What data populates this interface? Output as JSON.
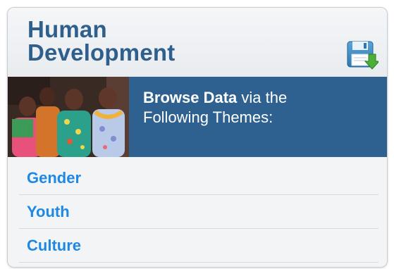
{
  "widget": {
    "title_line1": "Human",
    "title_line2": "Development",
    "save_icon": "save-download-icon"
  },
  "banner": {
    "photo_alt": "Group of women in floral dresses",
    "lead_bold": "Browse Data",
    "lead_rest": "via the",
    "line2": "Following Themes:"
  },
  "themes": [
    {
      "label": "Gender"
    },
    {
      "label": "Youth"
    },
    {
      "label": "Culture"
    }
  ],
  "colors": {
    "title": "#2f5f8c",
    "banner_bg": "#2e6190",
    "link": "#1e88e5"
  }
}
